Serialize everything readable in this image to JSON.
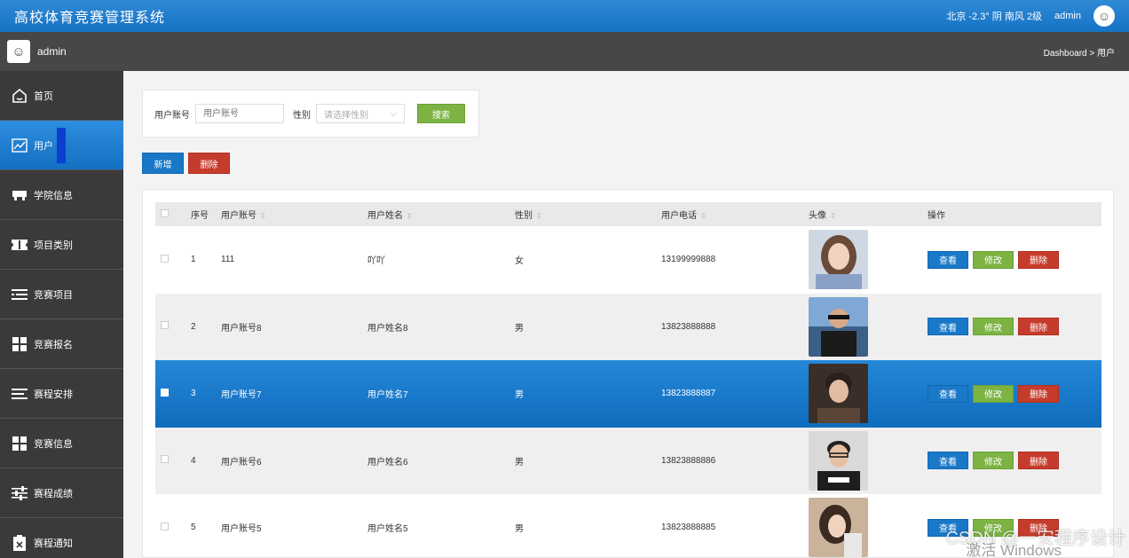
{
  "app": {
    "title": "高校体育竞赛管理系统"
  },
  "topbar": {
    "weather": "北京  -2.3°  阴  南风  2级",
    "username": "admin"
  },
  "subbar": {
    "username": "admin",
    "breadcrumb": "Dashboard > 用户"
  },
  "sidebar": {
    "items": [
      {
        "label": "首页",
        "icon": "home-icon"
      },
      {
        "label": "用户",
        "icon": "chart-icon",
        "active": true
      },
      {
        "label": "学院信息",
        "icon": "building-icon"
      },
      {
        "label": "项目类别",
        "icon": "ticket-icon"
      },
      {
        "label": "竞赛项目",
        "icon": "list-icon"
      },
      {
        "label": "竞赛报名",
        "icon": "grid-icon"
      },
      {
        "label": "赛程安排",
        "icon": "list-icon"
      },
      {
        "label": "竞赛信息",
        "icon": "grid-icon"
      },
      {
        "label": "赛程成绩",
        "icon": "sliders-icon"
      },
      {
        "label": "赛程通知",
        "icon": "clipboard-icon"
      }
    ]
  },
  "search": {
    "account_label": "用户账号",
    "account_placeholder": "用户账号",
    "gender_label": "性别",
    "gender_placeholder": "请选择性别",
    "search_button": "搜索"
  },
  "actions": {
    "add_button": "新增",
    "delete_button": "删除"
  },
  "table": {
    "headers": [
      "序号",
      "用户账号",
      "用户姓名",
      "性别",
      "用户电话",
      "头像",
      "操作"
    ],
    "rows": [
      {
        "index": "1",
        "account": "111",
        "name": "吖吖",
        "gender": "女",
        "phone": "13199999888",
        "selected": false
      },
      {
        "index": "2",
        "account": "用户账号8",
        "name": "用户姓名8",
        "gender": "男",
        "phone": "13823888888",
        "selected": false
      },
      {
        "index": "3",
        "account": "用户账号7",
        "name": "用户姓名7",
        "gender": "男",
        "phone": "13823888887",
        "selected": true
      },
      {
        "index": "4",
        "account": "用户账号6",
        "name": "用户姓名6",
        "gender": "男",
        "phone": "13823888886",
        "selected": false
      },
      {
        "index": "5",
        "account": "用户账号5",
        "name": "用户姓名5",
        "gender": "男",
        "phone": "13823888885",
        "selected": false
      }
    ],
    "op_labels": {
      "view": "查看",
      "edit": "修改",
      "delete": "删除"
    }
  },
  "watermark": {
    "text": "CSDN @一安程序设计",
    "windows": "激活 Windows"
  },
  "colors": {
    "primary": "#1a78c8",
    "success": "#7cb342",
    "danger": "#c63c2c",
    "sidebar": "#3a3a3a",
    "header": "#1672c4"
  }
}
